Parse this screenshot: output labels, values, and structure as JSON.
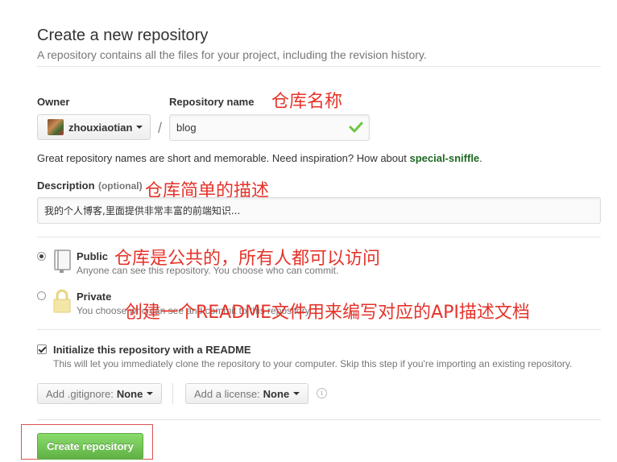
{
  "header": {
    "title": "Create a new repository",
    "subtitle": "A repository contains all the files for your project, including the revision history."
  },
  "owner": {
    "label": "Owner",
    "value": "zhouxiaotian"
  },
  "repo_name": {
    "label": "Repository name",
    "value": "blog",
    "status_icon": "check-icon"
  },
  "name_hint": {
    "text": "Great repository names are short and memorable. Need inspiration? How about ",
    "suggestion": "special-sniffle",
    "end": "."
  },
  "description": {
    "label": "Description",
    "optional": "(optional)",
    "value": "我的个人博客,里面提供非常丰富的前端知识..."
  },
  "visibility": {
    "public": {
      "title": "Public",
      "desc": "Anyone can see this repository. You choose who can commit.",
      "selected": true
    },
    "private": {
      "title": "Private",
      "desc": "You choose who can see and commit to this repository.",
      "selected": false
    }
  },
  "readme": {
    "title": "Initialize this repository with a README",
    "desc": "This will let you immediately clone the repository to your computer. Skip this step if you're importing an existing repository.",
    "checked": true
  },
  "gitignore": {
    "prefix": "Add .gitignore:",
    "value": "None"
  },
  "license": {
    "prefix": "Add a license:",
    "value": "None"
  },
  "create_button": "Create repository",
  "annotations": {
    "repo_name": "仓库名称",
    "description": "仓库简单的描述",
    "public": "仓库是公共的，所有人都可以访问",
    "readme": "创建一个README文件用来编写对应的API描述文档"
  },
  "colors": {
    "accent_green": "#60b044",
    "annotation_red": "#e5332a",
    "suggestion_green": "#1e6823"
  }
}
